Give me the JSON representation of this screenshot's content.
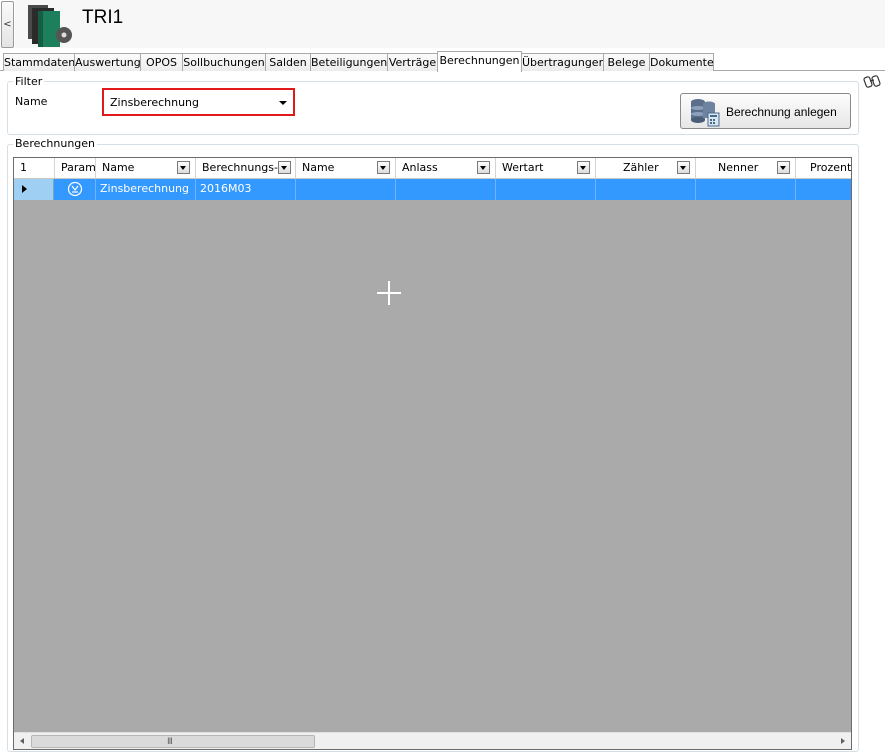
{
  "header": {
    "back_label": "<",
    "title": "TRI1"
  },
  "tabs": [
    {
      "label": "Stammdaten"
    },
    {
      "label": "Auswertung"
    },
    {
      "label": "OPOS"
    },
    {
      "label": "Sollbuchungen"
    },
    {
      "label": "Salden"
    },
    {
      "label": "Beteiligungen"
    },
    {
      "label": "Verträge"
    },
    {
      "label": "Berechnungen",
      "active": true
    },
    {
      "label": "Übertragungen"
    },
    {
      "label": "Belege"
    },
    {
      "label": "Dokumente"
    }
  ],
  "filter": {
    "group_title": "Filter",
    "name_label": "Name",
    "name_value": "Zinsberechnung",
    "create_button_label": "Berechnung anlegen"
  },
  "calculations": {
    "group_title": "Berechnungen",
    "columns": {
      "index": "1",
      "param": "Param",
      "name": "Name",
      "period": "Berechnungs-P",
      "name2": "Name",
      "occasion": "Anlass",
      "value_type": "Wertart",
      "numerator": "Zähler",
      "denominator": "Nenner",
      "percent": "Prozente"
    },
    "rows": [
      {
        "name": "Zinsberechnung",
        "period": "2016M03",
        "name2": "",
        "occasion": "",
        "value_type": "",
        "numerator": "",
        "denominator": "",
        "percent": ""
      }
    ]
  },
  "scrollbar": {
    "grip": "III"
  },
  "colors": {
    "selection": "#3399ff",
    "grid_background": "#aaaaaa",
    "highlight_border": "#e01a1a",
    "logo_green": "#1e7f5c"
  }
}
